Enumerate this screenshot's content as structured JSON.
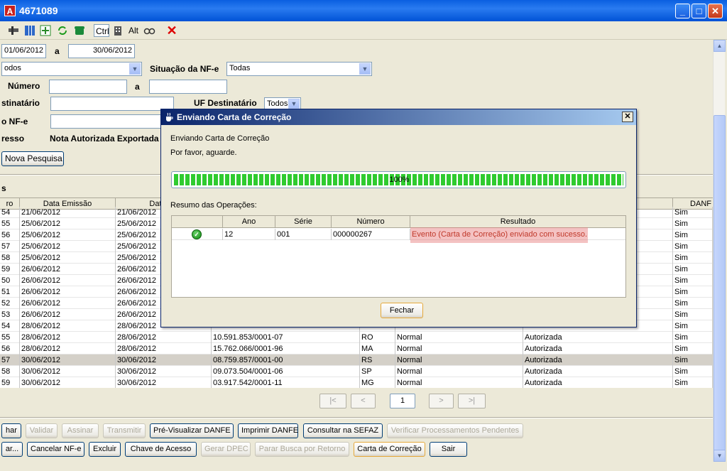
{
  "window": {
    "title": "4671089",
    "app_icon_letter": "A",
    "min": "_",
    "max": "□",
    "close": "✕"
  },
  "toolbar": {
    "ctrl": "Ctrl",
    "alt": "Alt"
  },
  "form": {
    "date_from": "01/06/2012",
    "date_sep": "a",
    "date_to": "30/06/2012",
    "filter_value": "odos",
    "situacao_label": "Situação da NF-e",
    "situacao_value": "Todas",
    "numero_label": "Número",
    "numero_sep": "a",
    "destinatario_label": "stinatário",
    "uf_label": "UF Destinatário",
    "uf_value": "Todos",
    "nfe_label": "o NF-e",
    "resso_label": "resso",
    "resso_value": "Nota Autorizada Exportada",
    "nova_pesquisa": "Nova Pesquisa",
    "s_label": "s"
  },
  "grid": {
    "headers": [
      "ro",
      "Data Emissão",
      "Data Au",
      "",
      "",
      "",
      "",
      "",
      "DANF"
    ],
    "rows": [
      {
        "n": "54",
        "emissao": "21/06/2012",
        "aut": "21/06/2012",
        "cnpj": "",
        "uf": "",
        "tipo": "",
        "sit": "",
        "danfe": "Sim"
      },
      {
        "n": "55",
        "emissao": "25/06/2012",
        "aut": "25/06/2012",
        "cnpj": "",
        "uf": "",
        "tipo": "",
        "sit": "",
        "danfe": "Sim"
      },
      {
        "n": "56",
        "emissao": "25/06/2012",
        "aut": "25/06/2012",
        "cnpj": "",
        "uf": "",
        "tipo": "",
        "sit": "",
        "danfe": "Sim"
      },
      {
        "n": "57",
        "emissao": "25/06/2012",
        "aut": "25/06/2012",
        "cnpj": "",
        "uf": "",
        "tipo": "",
        "sit": "",
        "danfe": "Sim"
      },
      {
        "n": "58",
        "emissao": "25/06/2012",
        "aut": "25/06/2012",
        "cnpj": "",
        "uf": "",
        "tipo": "",
        "sit": "",
        "danfe": "Sim"
      },
      {
        "n": "59",
        "emissao": "26/06/2012",
        "aut": "26/06/2012",
        "cnpj": "",
        "uf": "",
        "tipo": "",
        "sit": "",
        "danfe": "Sim"
      },
      {
        "n": "50",
        "emissao": "26/06/2012",
        "aut": "26/06/2012",
        "cnpj": "",
        "uf": "",
        "tipo": "",
        "sit": "",
        "danfe": "Sim"
      },
      {
        "n": "51",
        "emissao": "26/06/2012",
        "aut": "26/06/2012",
        "cnpj": "",
        "uf": "",
        "tipo": "",
        "sit": "",
        "danfe": "Sim"
      },
      {
        "n": "52",
        "emissao": "26/06/2012",
        "aut": "26/06/2012",
        "cnpj": "",
        "uf": "",
        "tipo": "",
        "sit": "",
        "danfe": "Sim"
      },
      {
        "n": "53",
        "emissao": "26/06/2012",
        "aut": "26/06/2012",
        "cnpj": "",
        "uf": "",
        "tipo": "",
        "sit": "",
        "danfe": "Sim"
      },
      {
        "n": "54",
        "emissao": "28/06/2012",
        "aut": "28/06/2012",
        "cnpj": "",
        "uf": "",
        "tipo": "",
        "sit": "",
        "danfe": "Sim"
      },
      {
        "n": "55",
        "emissao": "28/06/2012",
        "aut": "28/06/2012",
        "cnpj": "10.591.853/0001-07",
        "uf": "RO",
        "tipo": "Normal",
        "sit": "Autorizada",
        "danfe": "Sim"
      },
      {
        "n": "56",
        "emissao": "28/06/2012",
        "aut": "28/06/2012",
        "cnpj": "15.762.066/0001-96",
        "uf": "MA",
        "tipo": "Normal",
        "sit": "Autorizada",
        "danfe": "Sim"
      },
      {
        "n": "57",
        "emissao": "30/06/2012",
        "aut": "30/06/2012",
        "cnpj": "08.759.857/0001-00",
        "uf": "RS",
        "tipo": "Normal",
        "sit": "Autorizada",
        "danfe": "Sim",
        "selected": true
      },
      {
        "n": "58",
        "emissao": "30/06/2012",
        "aut": "30/06/2012",
        "cnpj": "09.073.504/0001-06",
        "uf": "SP",
        "tipo": "Normal",
        "sit": "Autorizada",
        "danfe": "Sim"
      },
      {
        "n": "59",
        "emissao": "30/06/2012",
        "aut": "30/06/2012",
        "cnpj": "03.917.542/0001-11",
        "uf": "MG",
        "tipo": "Normal",
        "sit": "Autorizada",
        "danfe": "Sim"
      }
    ]
  },
  "pagination": {
    "first": "|<",
    "prev": "<",
    "page": "1",
    "next": ">",
    "last": ">|"
  },
  "actions_row1": [
    "har",
    "Validar",
    "Assinar",
    "Transmitir",
    "Pré-Visualizar DANFE",
    "Imprimir DANFE",
    "Consultar na SEFAZ",
    "Verificar Processamentos Pendentes"
  ],
  "actions_row2": [
    "ar...",
    "Cancelar NF-e",
    "Excluir",
    "Chave de Acesso",
    "Gerar DPEC",
    "Parar Busca por Retorno",
    "Carta de Correção",
    "Sair"
  ],
  "dialog": {
    "title": "Enviando Carta de Correção",
    "close": "✕",
    "line1": "Enviando Carta de Correção",
    "line2": "Por favor, aguarde.",
    "progress_text": "100%",
    "progress_fraction": 1.0,
    "summary_label": "Resumo das Operações:",
    "table_headers": [
      "",
      "Ano",
      "Série",
      "Número",
      "Resultado"
    ],
    "row": {
      "status_icon": "check-icon",
      "ano": "12",
      "serie": "001",
      "numero": "000000267",
      "resultado": "Evento (Carta de Correção) enviado com sucesso."
    },
    "fechar": "Fechar"
  }
}
